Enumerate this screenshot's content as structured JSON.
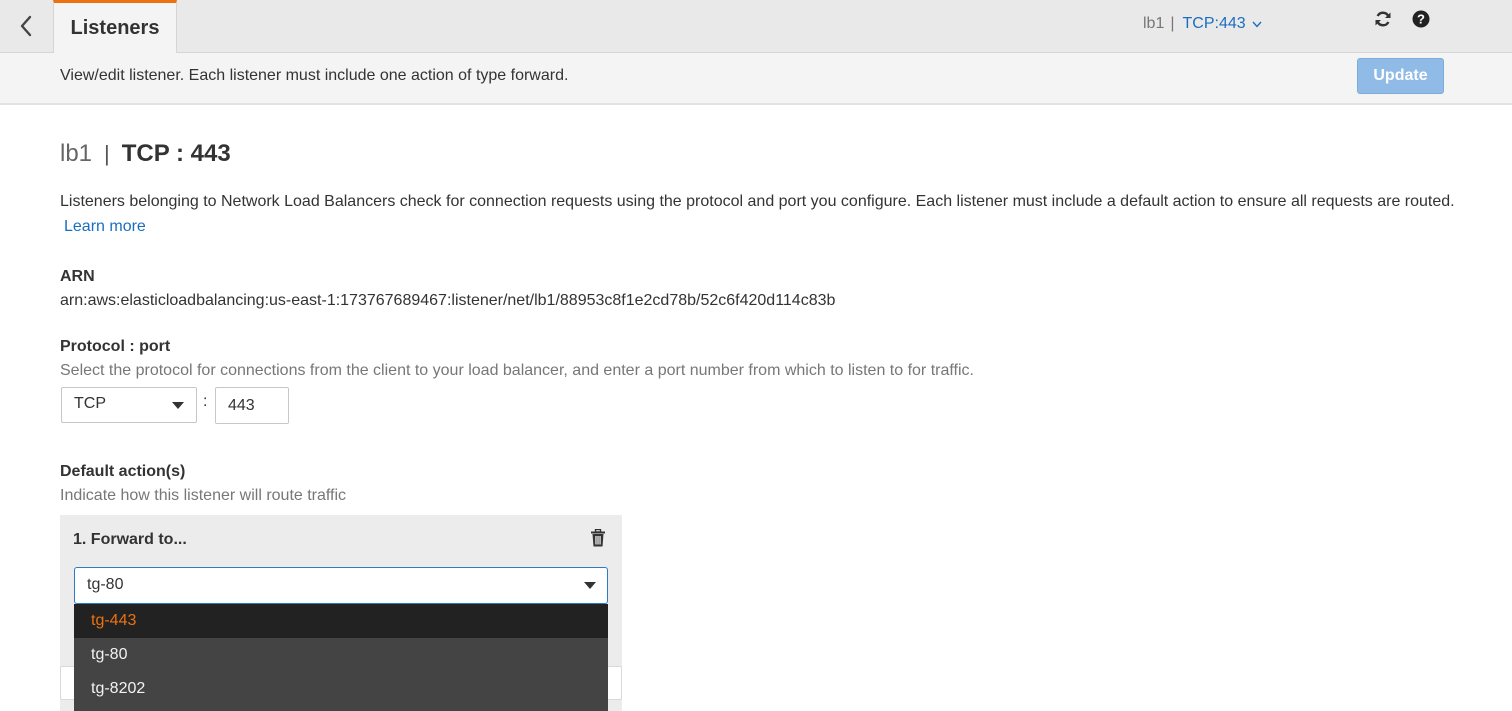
{
  "topbar": {
    "back_icon": "chevron-left-icon",
    "active_tab": "Listeners",
    "crumb_lb": "lb1",
    "crumb_sep": "|",
    "crumb_listener": "TCP:443",
    "refresh_icon": "refresh-icon",
    "help_icon": "help-icon",
    "accent_color": "#ec7211"
  },
  "subbar": {
    "text": "View/edit listener. Each listener must include one action of type forward.",
    "update_label": "Update"
  },
  "main": {
    "title_lb": "lb1",
    "title_sep": "|",
    "title_listener": "TCP : 443",
    "description": "Listeners belonging to Network Load Balancers check for connection requests using the protocol and port you configure. Each listener must include a default action to ensure all requests are routed.",
    "learn_more": "Learn more",
    "arn_label": "ARN",
    "arn_value": "arn:aws:elasticloadbalancing:us-east-1:173767689467:listener/net/lb1/88953c8f1e2cd78b/52c6f420d114c83b",
    "protocol_label": "Protocol : port",
    "protocol_hint": "Select the protocol for connections from the client to your load balancer, and enter a port number from which to listen to for traffic.",
    "protocol_value": "TCP",
    "colon": ":",
    "port_value": "443",
    "default_action_label": "Default action(s)",
    "default_action_hint": "Indicate how this listener will route traffic"
  },
  "action": {
    "title": "1. Forward to...",
    "selected": "tg-80",
    "dropdown_options": [
      "tg-443",
      "tg-80",
      "tg-8202"
    ],
    "highlighted_option": "tg-443"
  }
}
